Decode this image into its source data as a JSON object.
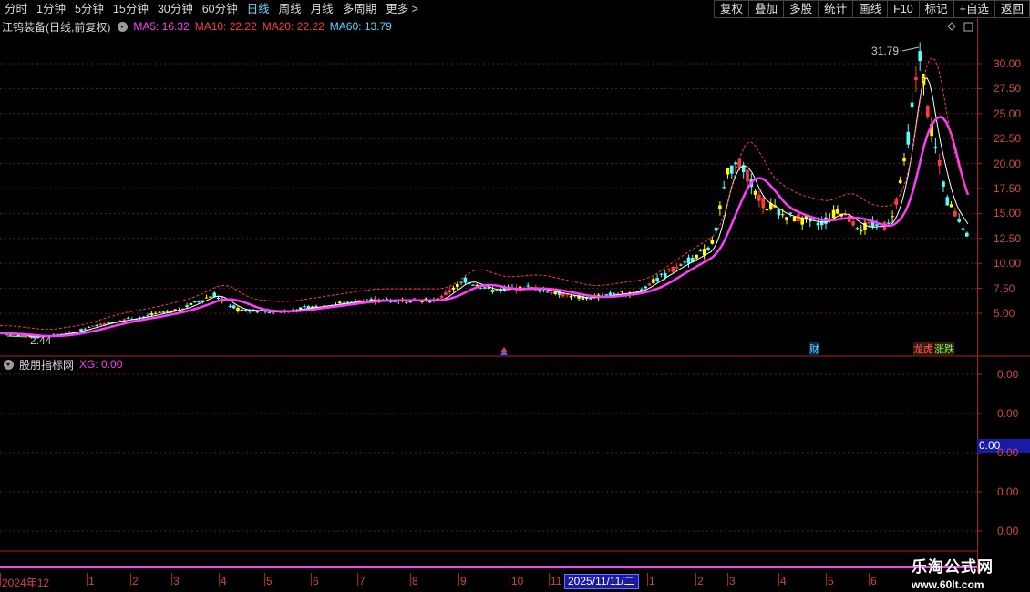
{
  "toolbar": {
    "periods": [
      "分时",
      "1分钟",
      "5分钟",
      "15分钟",
      "30分钟",
      "60分钟",
      "日线",
      "周线",
      "月线",
      "多周期",
      "更多 >"
    ],
    "active_period": "日线",
    "right_buttons": [
      "复权",
      "叠加",
      "多股",
      "统计",
      "画线",
      "F10",
      "标记",
      "+自选",
      "返回"
    ]
  },
  "kline_header": {
    "title": "江钨装备(日线,前复权)",
    "ma5": "MA5: 16.32",
    "ma10": "MA10: 22.22",
    "ma20": "MA20: 22.22",
    "ma60": "MA60: 13.79"
  },
  "indicator_header": {
    "title": "股朋指标网",
    "xg": "XG: 0.00"
  },
  "price_axis": [
    "30.00",
    "27.50",
    "25.00",
    "22.50",
    "20.00",
    "17.50",
    "15.00",
    "12.50",
    "10.00",
    "7.50",
    "5.00"
  ],
  "indicator_axis": [
    "0.00",
    "0.00",
    "0.00",
    "0.00",
    "0.00"
  ],
  "xg_badge": "0.00",
  "annotations": {
    "high": "31.79",
    "low": "2.44",
    "signal_cai": "财",
    "signal_long": "龙虎",
    "signal_zhangdie": "涨跌"
  },
  "dates": {
    "first": "2024年12",
    "months": [
      "1",
      "2",
      "3",
      "4",
      "5",
      "6",
      "7",
      "8",
      "9",
      "10",
      "11"
    ],
    "cursor": "2025/11/11/二",
    "months2": [
      "1",
      "2",
      "3",
      "4",
      "5",
      "6"
    ]
  },
  "colors": {
    "up": "#ff3c3c",
    "up_yellow": "#ffff00",
    "down": "#54ffff",
    "ma5": "#ffffff",
    "ma10": "#ff3c3c",
    "ma20": "#ff3cff",
    "ma60": "#5ad7ff"
  },
  "watermark": {
    "title": "乐淘公式网",
    "url": "www.60lt.com"
  }
}
